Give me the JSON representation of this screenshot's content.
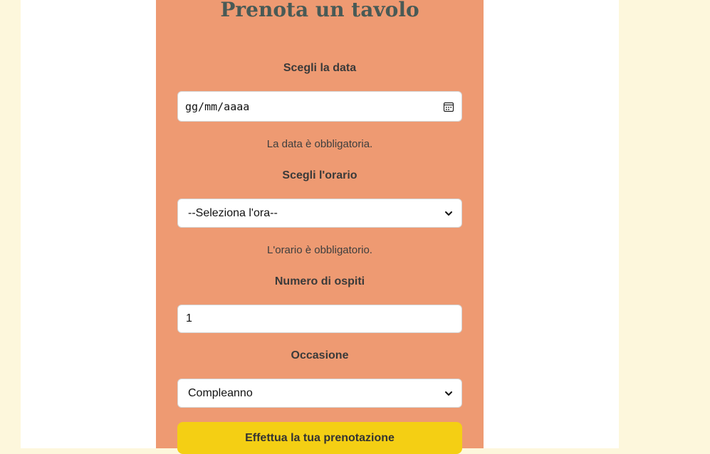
{
  "form": {
    "title": "Prenota un tavolo",
    "date": {
      "label": "Scegli la data",
      "placeholder": "gg/mm/aaaa",
      "help": "La data è obbligatoria."
    },
    "time": {
      "label": "Scegli l'orario",
      "selected": "--Seleziona l'ora--",
      "help": "L'orario è obbligatorio."
    },
    "guests": {
      "label": "Numero di ospiti",
      "value": "1"
    },
    "occasion": {
      "label": "Occasione",
      "selected": "Compleanno"
    },
    "submit_label": "Effettua la tua prenotazione"
  },
  "colors": {
    "page_background": "#fdf7dc",
    "card_background": "#ffffff",
    "panel_background": "#ee9a72",
    "title_color": "#485a56",
    "button_background": "#f4cf14"
  },
  "icons": {
    "date_picker": "calendar-icon",
    "select_arrow": "chevron-down-icon"
  }
}
